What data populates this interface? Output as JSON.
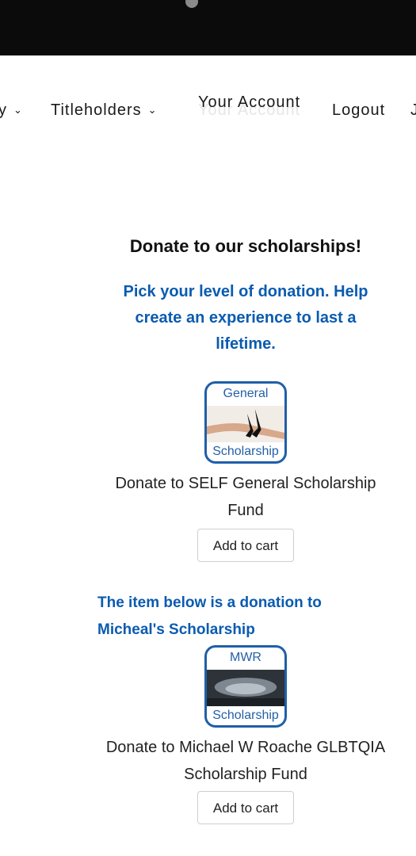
{
  "nav": {
    "items": [
      {
        "label": "y",
        "has_dropdown": true
      },
      {
        "label": "Titleholders",
        "has_dropdown": true
      },
      {
        "label": "Your Account",
        "has_dropdown": false
      },
      {
        "label": "Logout",
        "has_dropdown": false
      },
      {
        "label": "J",
        "has_dropdown": false
      }
    ],
    "account_ghost": "Your Account"
  },
  "main": {
    "heading": "Donate to our scholarships!",
    "subheading": "Pick your level of donation. Help create an experience to last a lifetime.",
    "products": [
      {
        "image_top": "General",
        "image_bottom": "Scholarship",
        "title": "Donate to SELF General Scholarship Fund",
        "button": "Add to cart"
      },
      {
        "image_top": "MWR",
        "image_bottom": "Scholarship",
        "title": "Donate to Michael W Roache GLBTQIA Scholarship Fund",
        "button": "Add to cart"
      }
    ],
    "note": "The item below is a donation to Micheal's Scholarship"
  },
  "colors": {
    "topbar": "#0b0b0b",
    "accent_blue": "#0a5bb0",
    "icon_border": "#1f5fa8"
  }
}
